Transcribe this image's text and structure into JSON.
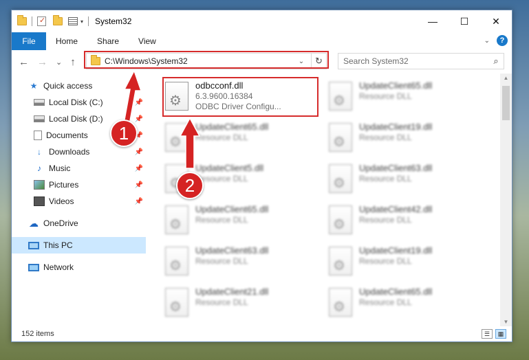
{
  "window": {
    "title": "System32",
    "controls": {
      "minimize": "—",
      "maximize": "☐",
      "close": "✕"
    }
  },
  "ribbon": {
    "file": "File",
    "tabs": [
      "Home",
      "Share",
      "View"
    ]
  },
  "navigation": {
    "back": "←",
    "forward": "→",
    "recent": "⌄",
    "up": "↑",
    "address": "C:\\Windows\\System32",
    "search_placeholder": "Search System32"
  },
  "sidebar": {
    "items": [
      {
        "label": "Quick access",
        "icon": "star-icon"
      },
      {
        "label": "Local Disk (C:)",
        "icon": "disk-icon"
      },
      {
        "label": "Local Disk (D:)",
        "icon": "disk-icon"
      },
      {
        "label": "Documents",
        "icon": "document-icon"
      },
      {
        "label": "Downloads",
        "icon": "download-icon"
      },
      {
        "label": "Music",
        "icon": "music-icon"
      },
      {
        "label": "Pictures",
        "icon": "pictures-icon"
      },
      {
        "label": "Videos",
        "icon": "video-icon"
      },
      {
        "label": "OneDrive",
        "icon": "cloud-icon"
      },
      {
        "label": "This PC",
        "icon": "computer-icon"
      },
      {
        "label": "Network",
        "icon": "network-icon"
      }
    ]
  },
  "files": {
    "highlighted": {
      "name": "odbcconf.dll",
      "version": "6.3.9600.16384",
      "description": "ODBC Driver Configu..."
    },
    "col1": [
      {
        "name": "UpdateClient65.dll",
        "type": "Resource DLL"
      },
      {
        "name": "UpdateClient5.dll",
        "type": "Resource DLL"
      },
      {
        "name": "UpdateClient65.dll",
        "type": "Resource DLL"
      },
      {
        "name": "UpdateClient63.dll",
        "type": "Resource DLL"
      },
      {
        "name": "UpdateClient21.dll",
        "type": "Resource DLL"
      }
    ],
    "col2": [
      {
        "name": "UpdateClient65.dll",
        "type": "Resource DLL"
      },
      {
        "name": "UpdateClient19.dll",
        "type": "Resource DLL"
      },
      {
        "name": "UpdateClient63.dll",
        "type": "Resource DLL"
      },
      {
        "name": "UpdateClient42.dll",
        "type": "Resource DLL"
      },
      {
        "name": "UpdateClient19.dll",
        "type": "Resource DLL"
      },
      {
        "name": "UpdateClient65.dll",
        "type": "Resource DLL"
      }
    ]
  },
  "status": {
    "count": "152 items"
  },
  "annotations": {
    "step1": "1",
    "step2": "2",
    "highlight_color": "#d62b2b",
    "badge_color": "#d52323"
  }
}
